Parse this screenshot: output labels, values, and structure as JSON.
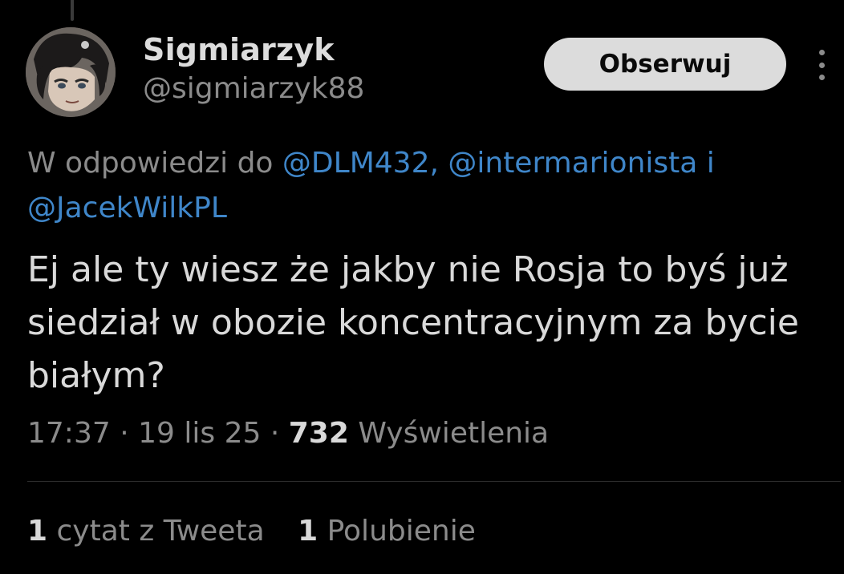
{
  "author": {
    "display_name": "Sigmiarzyk",
    "handle": "@sigmiarzyk88",
    "avatar_icon": "anime-character-avatar"
  },
  "follow_button": {
    "label": "Obserwuj"
  },
  "more_menu": {
    "icon": "more-vertical-icon"
  },
  "reply_context": {
    "prefix": "W odpowiedzi do",
    "mentions": [
      "@DLM432,",
      "@intermarionista",
      "i",
      "@JacekWilkPL"
    ]
  },
  "tweet": {
    "text": "Ej ale ty wiesz że jakby nie Rosja to byś już siedział w obozie koncentracyjnym za bycie białym?"
  },
  "meta": {
    "time": "17:37",
    "separator": "·",
    "date": "19 lis 25",
    "views_count": "732",
    "views_label": "Wyświetlenia"
  },
  "stats": {
    "quotes_count": "1",
    "quotes_label": "cytat z Tweeta",
    "likes_count": "1",
    "likes_label": "Polubienie"
  },
  "colors": {
    "background": "#000000",
    "text_primary": "#d9d9d9",
    "text_secondary": "#8b8b8b",
    "mention_blue": "#3f86c9",
    "button_bg": "#dcdcdc"
  }
}
